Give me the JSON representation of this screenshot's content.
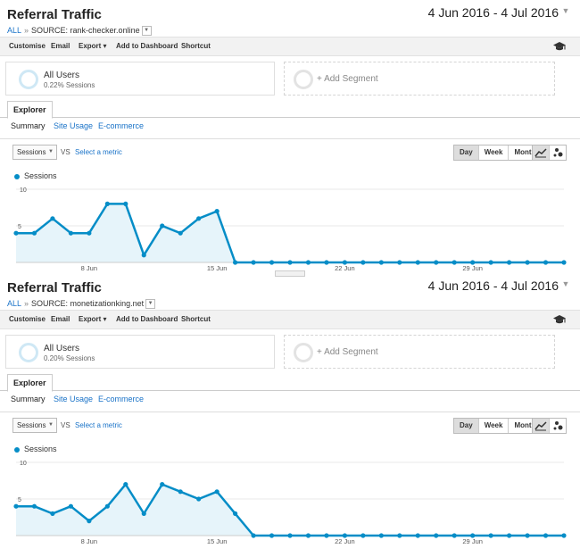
{
  "panels": [
    {
      "title": "Referral Traffic",
      "date_range": "4 Jun 2016 - 4 Jul 2016",
      "breadcrumb": {
        "all": "ALL",
        "sep": "»",
        "source": "SOURCE: rank-checker.online"
      },
      "toolbar": {
        "customise": "Customise",
        "email": "Email",
        "export": "Export ▾",
        "dashboard": "Add to Dashboard",
        "shortcut": "Shortcut"
      },
      "segment": {
        "name": "All Users",
        "sub": "0.22% Sessions",
        "add": "+ Add Segment"
      },
      "tab": "Explorer",
      "subtabs": {
        "summary": "Summary",
        "usage": "Site Usage",
        "ecommerce": "E-commerce"
      },
      "metric": "Sessions",
      "vs": "VS",
      "select_metric": "Select a metric",
      "granularity": [
        "Day",
        "Week",
        "Month"
      ],
      "legend": "Sessions",
      "chart_data": {
        "type": "area",
        "series": [
          {
            "name": "Sessions",
            "values": [
              4,
              4,
              6,
              4,
              4,
              8,
              8,
              1,
              5,
              4,
              6,
              7,
              0,
              0,
              0,
              0,
              0,
              0,
              0,
              0,
              0,
              0,
              0,
              0,
              0,
              0,
              0,
              0,
              0,
              0,
              0
            ]
          }
        ],
        "x_tick_labels": [
          "8 Jun",
          "15 Jun",
          "22 Jun",
          "29 Jun"
        ],
        "y_tick_labels": [
          "10",
          "5"
        ],
        "ylim": [
          0,
          10
        ],
        "color": "#058dc7"
      }
    },
    {
      "title": "Referral Traffic",
      "date_range": "4 Jun 2016 - 4 Jul 2016",
      "breadcrumb": {
        "all": "ALL",
        "sep": "»",
        "source": "SOURCE: monetizationking.net"
      },
      "toolbar": {
        "customise": "Customise",
        "email": "Email",
        "export": "Export ▾",
        "dashboard": "Add to Dashboard",
        "shortcut": "Shortcut"
      },
      "segment": {
        "name": "All Users",
        "sub": "0.20% Sessions",
        "add": "+ Add Segment"
      },
      "tab": "Explorer",
      "subtabs": {
        "summary": "Summary",
        "usage": "Site Usage",
        "ecommerce": "E-commerce"
      },
      "metric": "Sessions",
      "vs": "VS",
      "select_metric": "Select a metric",
      "granularity": [
        "Day",
        "Week",
        "Month"
      ],
      "legend": "Sessions",
      "chart_data": {
        "type": "area",
        "series": [
          {
            "name": "Sessions",
            "values": [
              4,
              4,
              3,
              4,
              2,
              4,
              7,
              3,
              7,
              6,
              5,
              6,
              3,
              0,
              0,
              0,
              0,
              0,
              0,
              0,
              0,
              0,
              0,
              0,
              0,
              0,
              0,
              0,
              0,
              0,
              0
            ]
          }
        ],
        "x_tick_labels": [
          "8 Jun",
          "15 Jun",
          "22 Jun",
          "29 Jun"
        ],
        "y_tick_labels": [
          "10",
          "5"
        ],
        "ylim": [
          0,
          10
        ],
        "color": "#058dc7"
      }
    }
  ]
}
